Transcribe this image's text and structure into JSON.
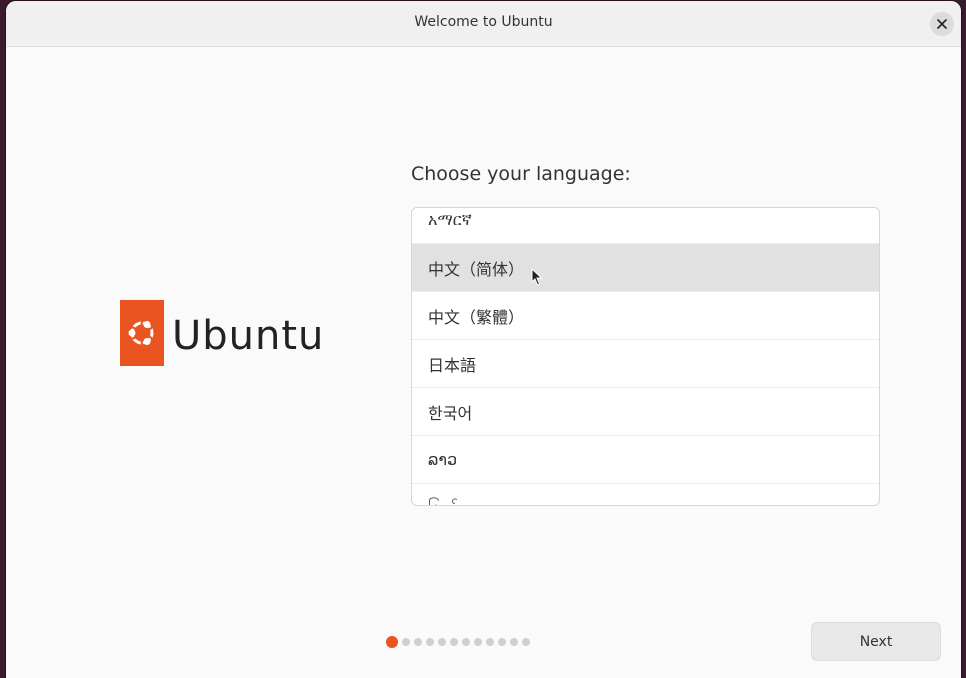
{
  "window": {
    "title": "Welcome to Ubuntu",
    "close_icon": "close-icon"
  },
  "brand": {
    "name": "Ubuntu",
    "color": "#e95420"
  },
  "page": {
    "heading": "Choose your language:",
    "languages": [
      {
        "label": "አማርኛ",
        "selected": false
      },
      {
        "label": "中文（简体）",
        "selected": true
      },
      {
        "label": "中文（繁體）",
        "selected": false
      },
      {
        "label": "日本語",
        "selected": false
      },
      {
        "label": "한국어",
        "selected": false
      },
      {
        "label": "ລາວ",
        "selected": false
      },
      {
        "label": "ြမန်မာ",
        "selected": false
      }
    ]
  },
  "progress": {
    "total_steps": 12,
    "current_step": 1
  },
  "footer": {
    "next_label": "Next"
  }
}
